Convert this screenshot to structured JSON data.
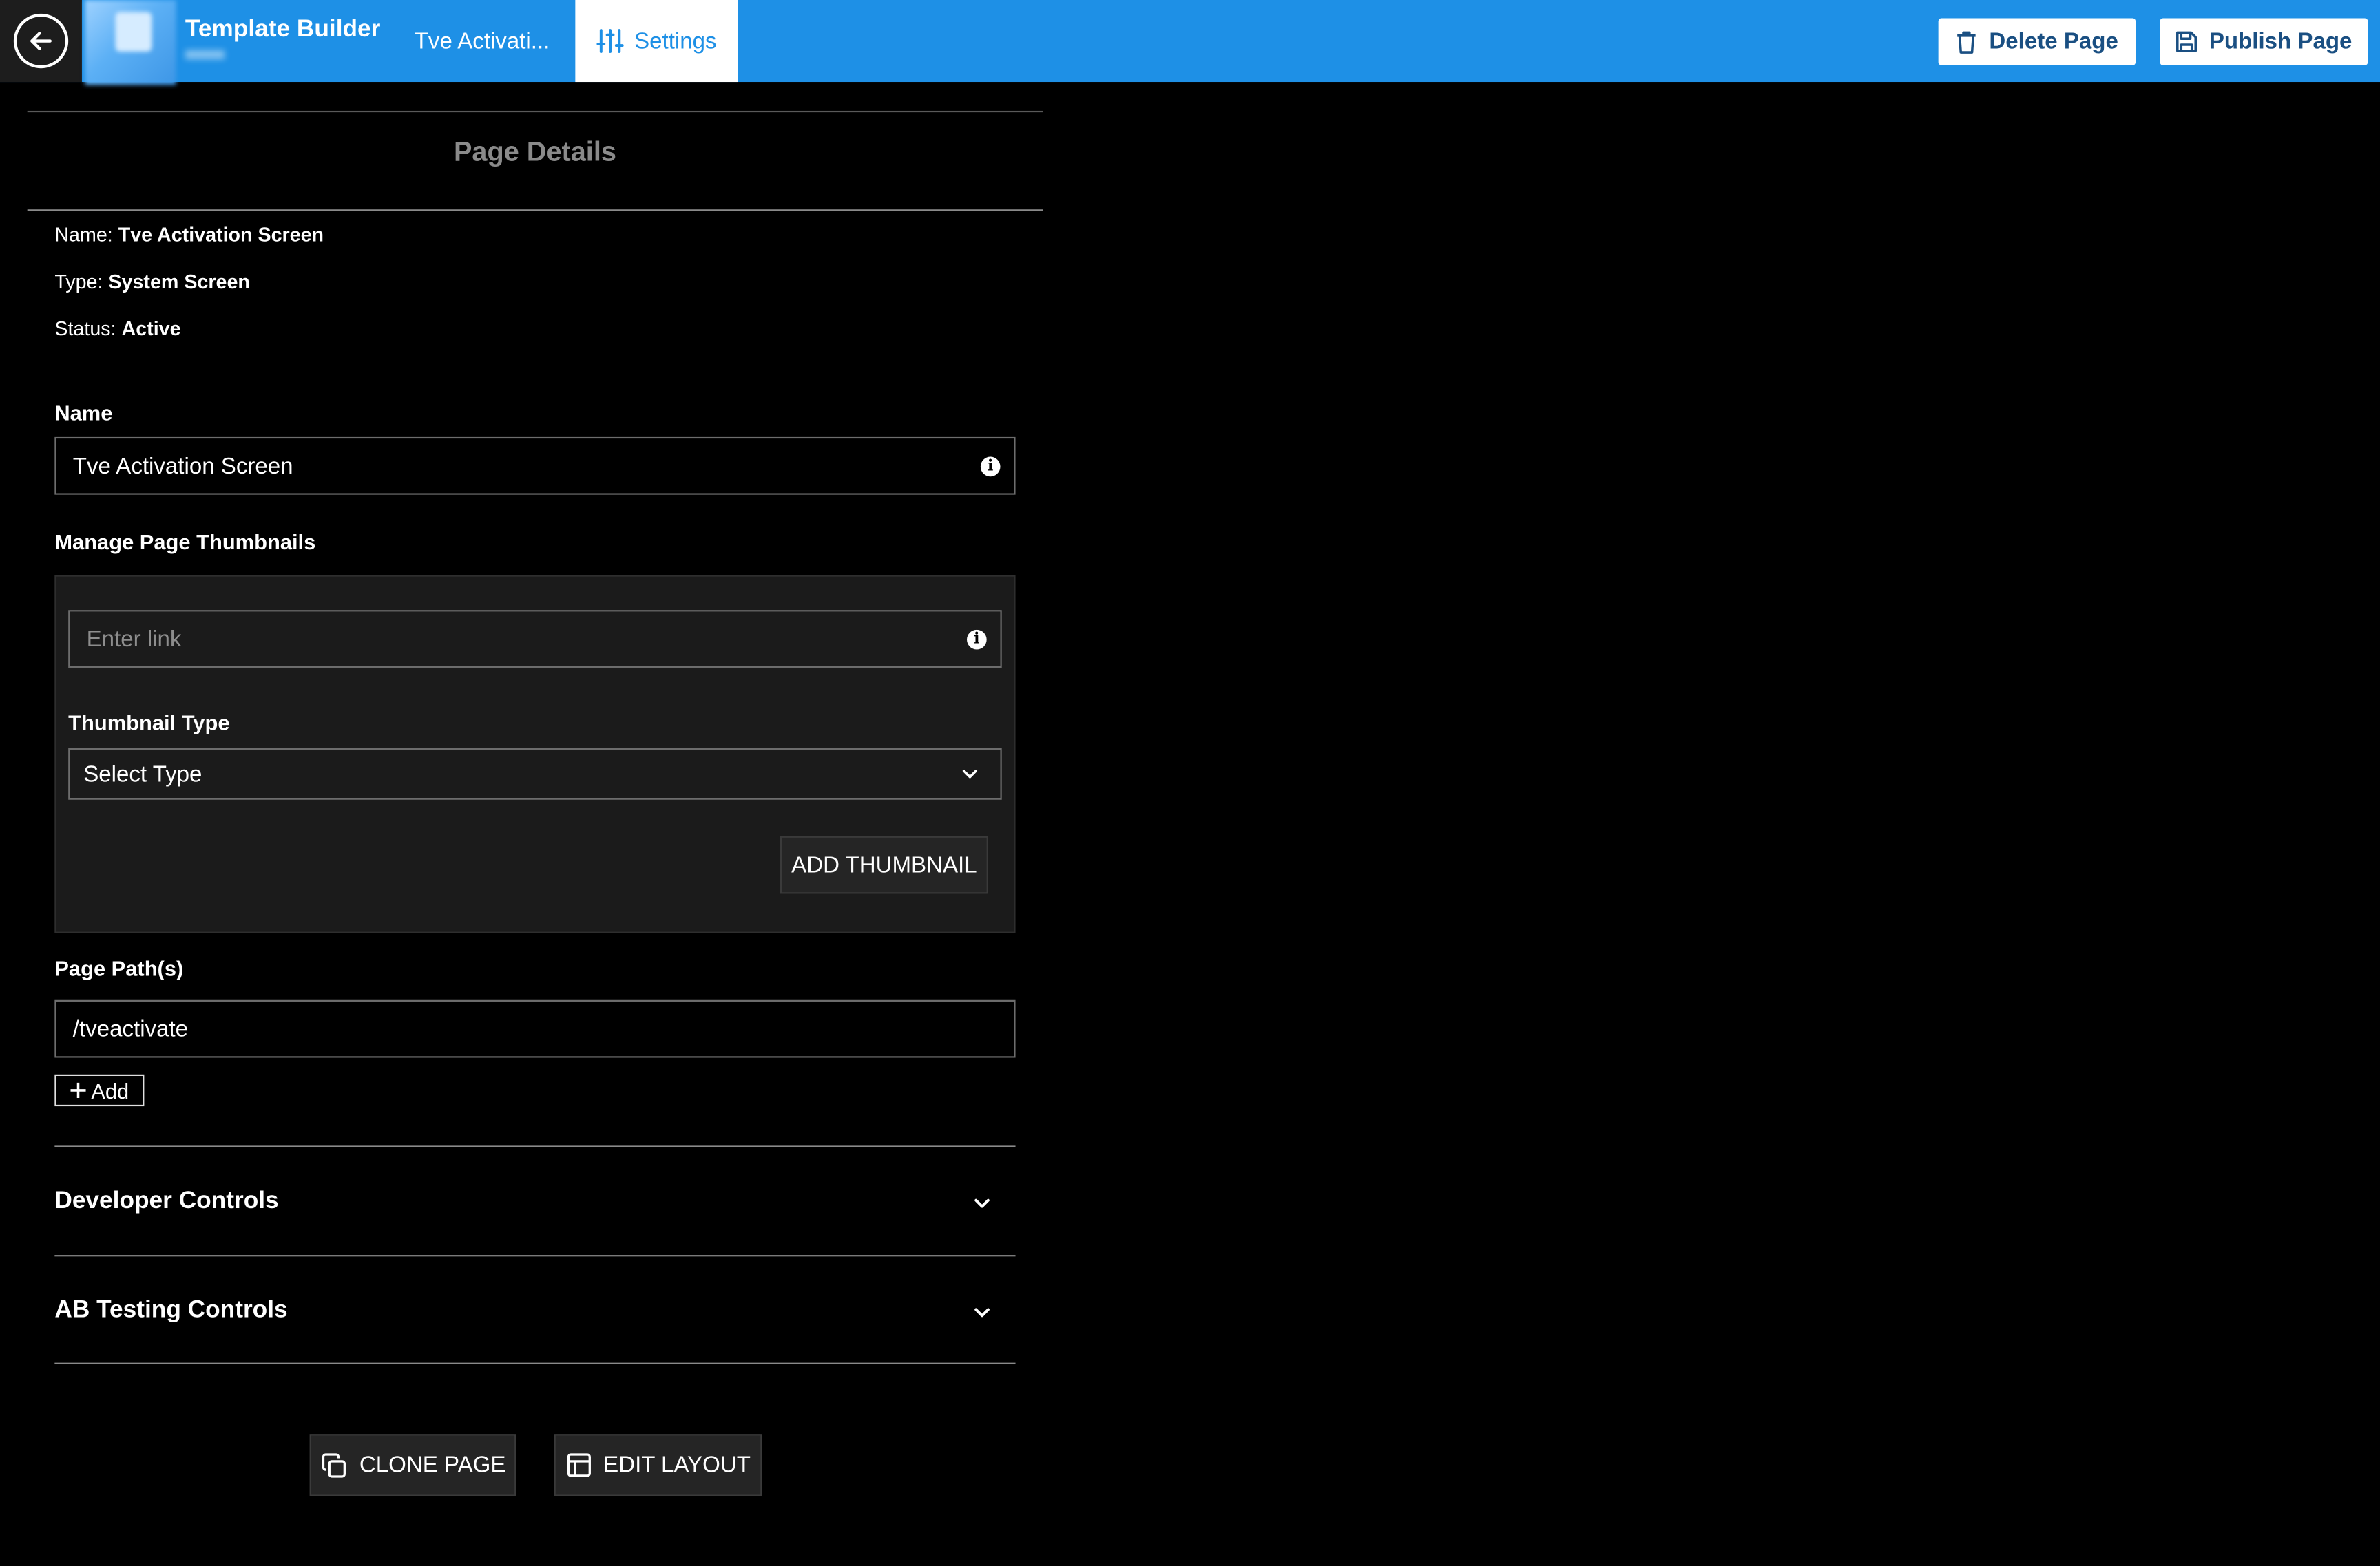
{
  "header": {
    "app_title": "Template Builder",
    "page_tab": "Tve Activati...",
    "settings_tab": "Settings",
    "delete_label": "Delete Page",
    "publish_label": "Publish Page",
    "accent_color": "#1e90e6"
  },
  "details": {
    "title": "Page Details",
    "name_key": "Name:",
    "name_value": "Tve Activation Screen",
    "type_key": "Type:",
    "type_value": "System Screen",
    "status_key": "Status:",
    "status_value": "Active"
  },
  "form": {
    "name_label": "Name",
    "name_value": "Tve Activation Screen",
    "thumbnails_label": "Manage Page Thumbnails",
    "link_placeholder": "Enter link",
    "thumbnail_type_label": "Thumbnail Type",
    "thumbnail_type_value": "Select Type",
    "add_thumbnail_label": "ADD THUMBNAIL",
    "paths_label": "Page Path(s)",
    "path_value": "/tveactivate",
    "add_label": "Add"
  },
  "sections": {
    "developer": "Developer Controls",
    "ab_testing": "AB Testing Controls"
  },
  "footer": {
    "clone_label": "CLONE PAGE",
    "edit_layout_label": "EDIT LAYOUT"
  },
  "icons": [
    "arrow-left-icon",
    "sliders-icon",
    "trash-icon",
    "save-icon",
    "info-icon",
    "chevron-down-icon",
    "plus-icon",
    "copy-icon",
    "layout-icon"
  ]
}
